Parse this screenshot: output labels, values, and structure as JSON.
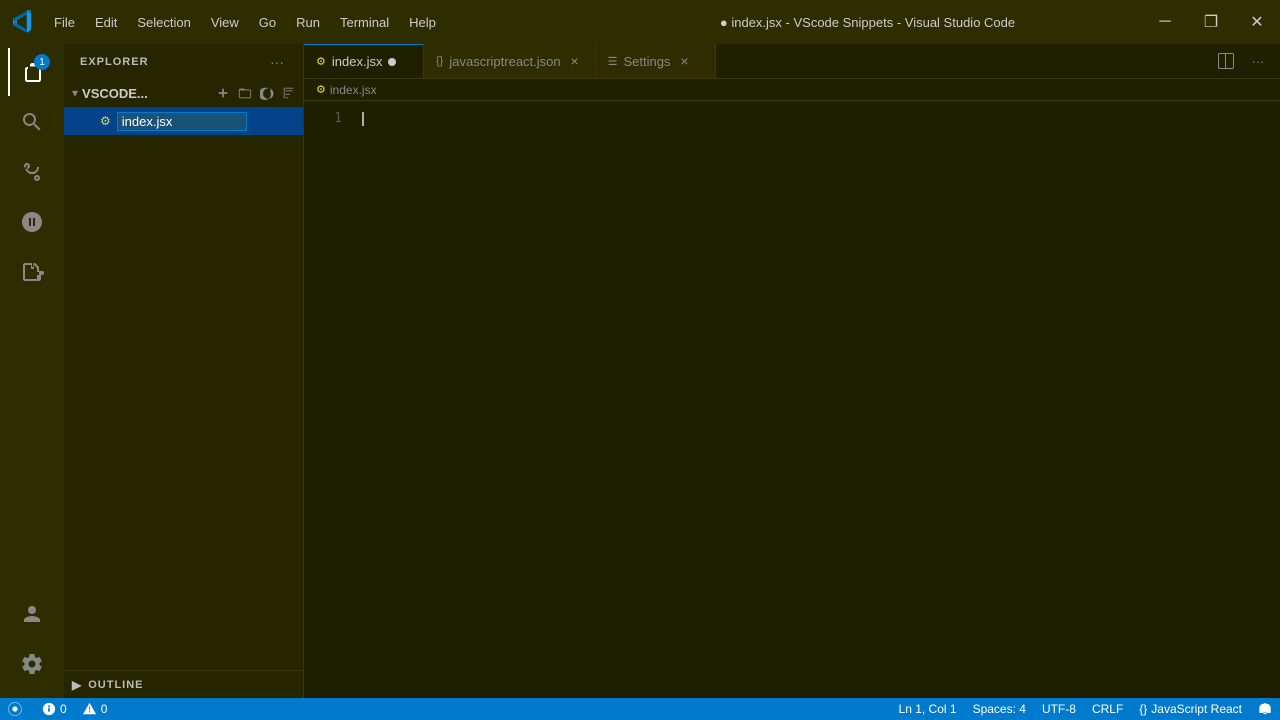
{
  "titleBar": {
    "title": "● index.jsx - VScode Snippets - Visual Studio Code",
    "logoAlt": "VS Code Logo",
    "menu": [
      "File",
      "Edit",
      "Selection",
      "View",
      "Go",
      "Run",
      "Terminal",
      "Help"
    ],
    "windowControls": {
      "minimize": "─",
      "maximize": "❐",
      "close": "✕"
    }
  },
  "activityBar": {
    "items": [
      {
        "name": "explorer",
        "icon": "files",
        "active": true,
        "badge": "1"
      },
      {
        "name": "search",
        "icon": "search",
        "active": false
      },
      {
        "name": "source-control",
        "icon": "source-control",
        "active": false
      },
      {
        "name": "run-debug",
        "icon": "run",
        "active": false
      },
      {
        "name": "extensions",
        "icon": "extensions",
        "active": false
      }
    ],
    "bottomItems": [
      {
        "name": "accounts",
        "icon": "account"
      },
      {
        "name": "settings",
        "icon": "gear"
      }
    ]
  },
  "sidebar": {
    "title": "EXPLORER",
    "moreActions": "···",
    "folder": {
      "name": "VSCODE...",
      "collapsed": false,
      "actions": [
        "new-file",
        "new-folder",
        "refresh",
        "collapse"
      ]
    },
    "files": [
      {
        "name": "index.jsx",
        "active": true,
        "icon": "⚙"
      }
    ],
    "outline": {
      "label": "OUTLINE",
      "collapsed": true
    }
  },
  "tabs": [
    {
      "name": "index.jsx",
      "active": true,
      "modified": true,
      "icon": "jsx"
    },
    {
      "name": "javascriptreact.json",
      "active": false,
      "modified": false,
      "icon": "json"
    },
    {
      "name": "Settings",
      "active": false,
      "modified": false,
      "icon": "settings"
    }
  ],
  "breadcrumb": {
    "file": "index.jsx"
  },
  "editor": {
    "lineNumbers": [
      "1"
    ],
    "content": ""
  },
  "statusBar": {
    "left": [
      {
        "icon": "remote",
        "text": ""
      },
      {
        "icon": "error",
        "text": "0"
      },
      {
        "icon": "warning",
        "text": "0"
      }
    ],
    "right": [
      {
        "text": "Ln 1, Col 1"
      },
      {
        "text": "Spaces: 4"
      },
      {
        "text": "UTF-8"
      },
      {
        "text": "CRLF"
      },
      {
        "text": "{ } JavaScript React"
      },
      {
        "icon": "bell"
      }
    ]
  }
}
